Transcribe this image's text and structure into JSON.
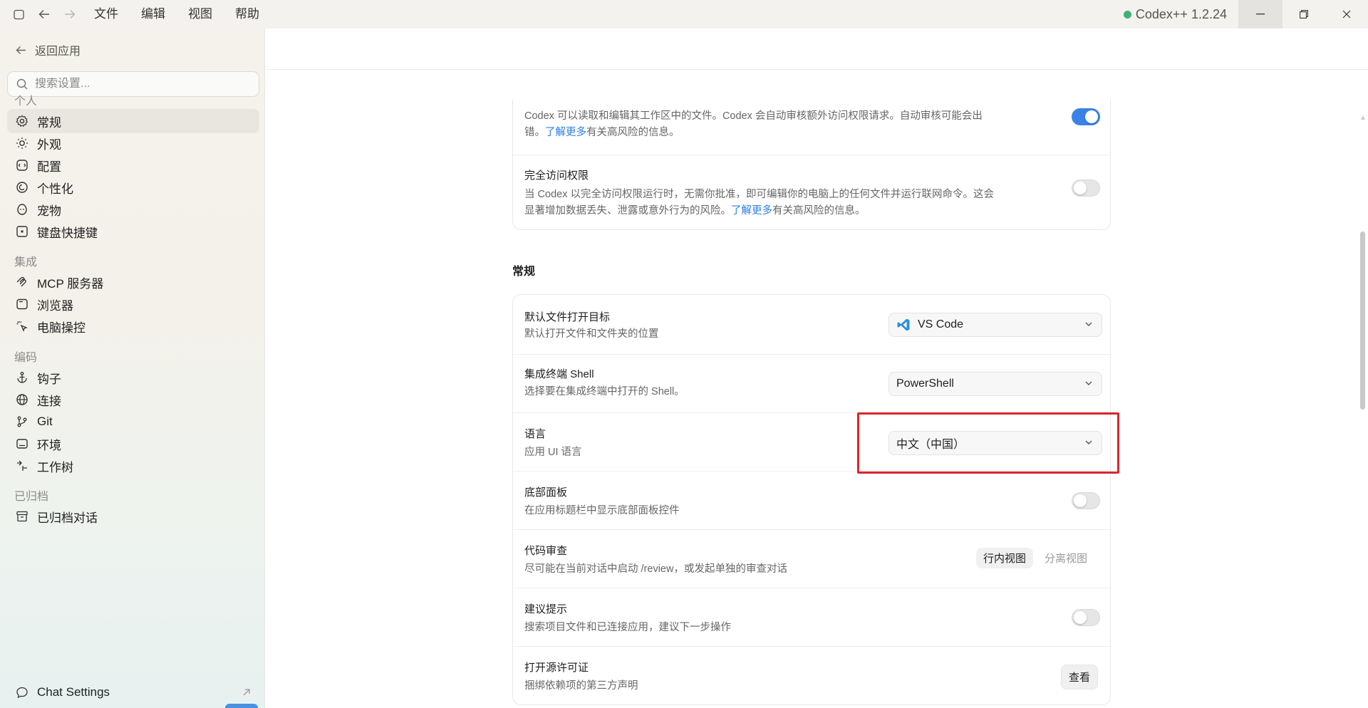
{
  "titlebar": {
    "menu": [
      "文件",
      "编辑",
      "视图",
      "帮助"
    ],
    "app_version": "Codex++ 1.2.24",
    "status_color": "#3cb371"
  },
  "sidebar": {
    "back_label": "返回应用",
    "search_placeholder": "搜索设置...",
    "sections": {
      "personal": "个人",
      "integration": "集成",
      "coding": "编码",
      "archived": "已归档"
    },
    "items": {
      "general": "常规",
      "appearance": "外观",
      "config": "配置",
      "personalize": "个性化",
      "pets": "宠物",
      "shortcuts": "键盘快捷键",
      "mcp": "MCP 服务器",
      "browser": "浏览器",
      "computer_control": "电脑操控",
      "hooks": "钩子",
      "connections": "连接",
      "git": "Git",
      "environment": "环境",
      "worktree": "工作树",
      "archived_chats": "已归档对话",
      "chat_settings": "Chat Settings"
    }
  },
  "permissions_card": {
    "auto_review_desc_1": "Codex 可以读取和编辑其工作区中的文件。Codex 会自动审核额外访问权限请求。自动审核可能会出",
    "auto_review_desc_2a": "错。",
    "auto_review_link": "了解更多",
    "auto_review_desc_2b": "有关高风险的信息。",
    "auto_review_on": true,
    "full_access_title": "完全访问权限",
    "full_access_desc_1": "当 Codex 以完全访问权限运行时，无需你批准，即可编辑你的电脑上的任何文件并运行联网命令。这会",
    "full_access_desc_2a": "显著增加数据丢失、泄露或意外行为的风险。",
    "full_access_link": "了解更多",
    "full_access_desc_2b": "有关高风险的信息。",
    "full_access_on": false
  },
  "general": {
    "section_title": "常规",
    "open_target_title": "默认文件打开目标",
    "open_target_desc": "默认打开文件和文件夹的位置",
    "open_target_value": "VS Code",
    "shell_title": "集成终端 Shell",
    "shell_desc": "选择要在集成终端中打开的 Shell。",
    "shell_value": "PowerShell",
    "language_title": "语言",
    "language_desc": "应用 UI 语言",
    "language_value": "中文（中国）",
    "bottom_panel_title": "底部面板",
    "bottom_panel_desc": "在应用标题栏中显示底部面板控件",
    "bottom_panel_on": false,
    "code_review_title": "代码审查",
    "code_review_desc": "尽可能在当前对话中启动 /review，或发起单独的审查对话",
    "code_review_inline": "行内视图",
    "code_review_split": "分离视图",
    "suggestions_title": "建议提示",
    "suggestions_desc": "搜索项目文件和已连接应用，建议下一步操作",
    "suggestions_on": false,
    "license_title": "打开源许可证",
    "license_desc": "捆绑依赖项的第三方声明",
    "license_button": "查看"
  },
  "colors": {
    "accent": "#3b82e6",
    "link": "#2b7de9",
    "highlight": "#d9262e"
  }
}
